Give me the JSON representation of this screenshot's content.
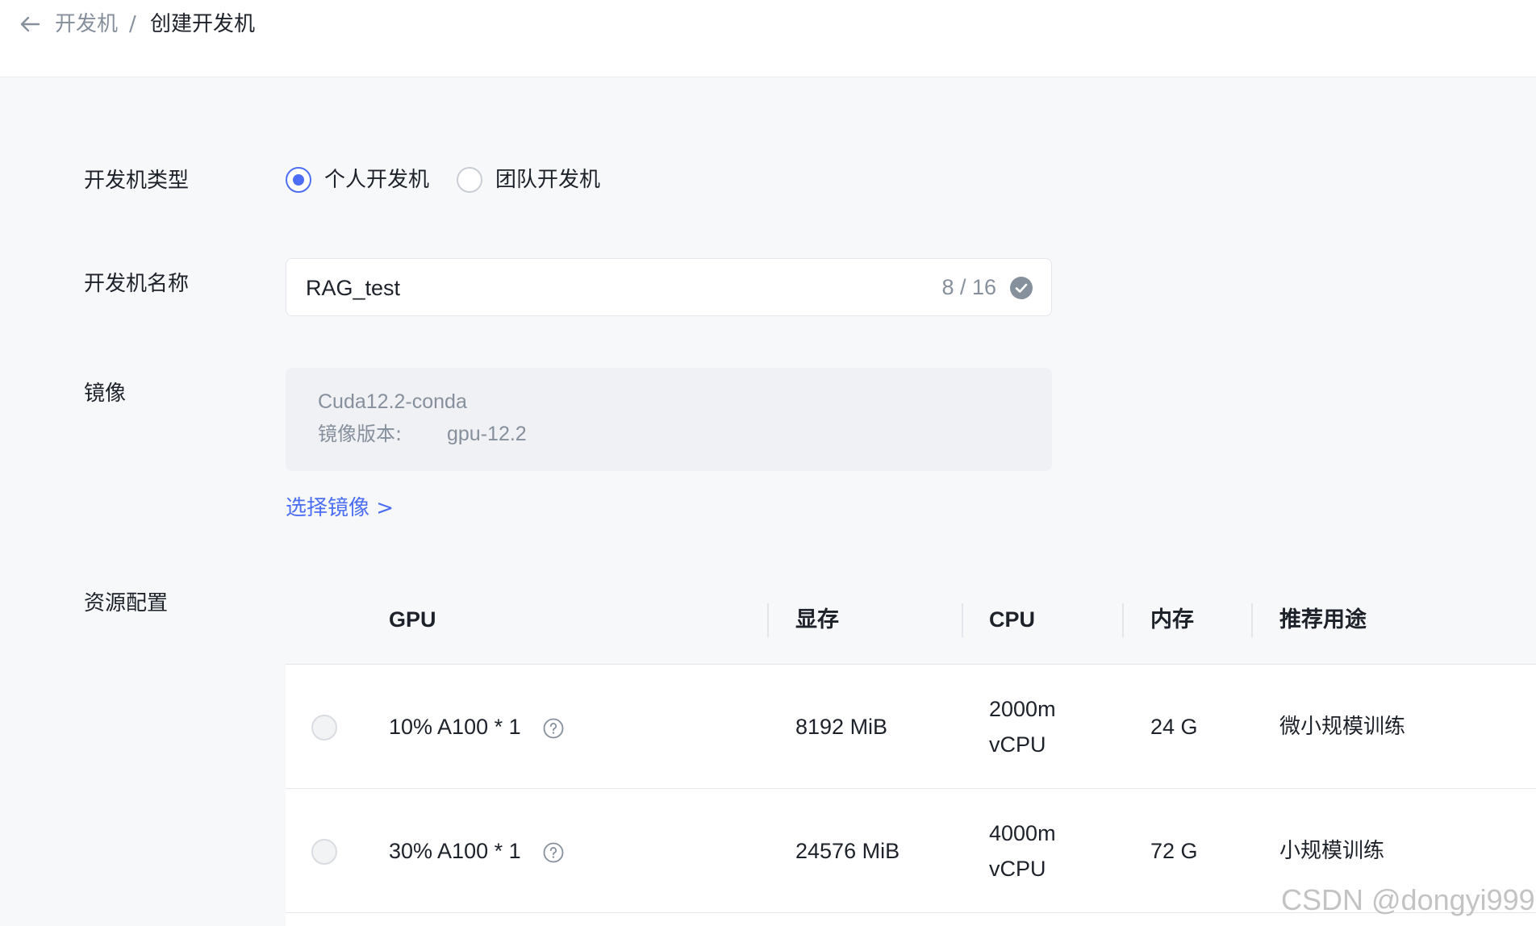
{
  "breadcrumb": {
    "back_icon": "arrow-left-icon",
    "parent": "开发机",
    "separator": "/",
    "current": "创建开发机"
  },
  "form": {
    "type": {
      "label": "开发机类型",
      "options": [
        {
          "label": "个人开发机",
          "checked": true
        },
        {
          "label": "团队开发机",
          "checked": false
        }
      ]
    },
    "name": {
      "label": "开发机名称",
      "value": "RAG_test",
      "counter": "8 / 16",
      "status_icon": "check-circle-icon"
    },
    "image": {
      "label": "镜像",
      "name": "Cuda12.2-conda",
      "version_label": "镜像版本:",
      "version_value": "gpu-12.2",
      "select_link": "选择镜像 >"
    },
    "resource": {
      "label": "资源配置",
      "columns": [
        "GPU",
        "显存",
        "CPU",
        "内存",
        "推荐用途"
      ],
      "rows": [
        {
          "gpu": "10% A100 * 1",
          "vram": "8192 MiB",
          "cpu_line1": "2000m",
          "cpu_line2": "vCPU",
          "memory": "24 G",
          "usage": "微小规模训练",
          "selected": false
        },
        {
          "gpu": "30% A100 * 1",
          "vram": "24576 MiB",
          "cpu_line1": "4000m",
          "cpu_line2": "vCPU",
          "memory": "72 G",
          "usage": "小规模训练",
          "selected": false
        }
      ]
    }
  },
  "colors": {
    "accent": "#4c6ef5",
    "text": "#1d2129",
    "muted": "#86909c",
    "background": "#f7f8fa"
  },
  "watermark": "CSDN @dongyi999"
}
